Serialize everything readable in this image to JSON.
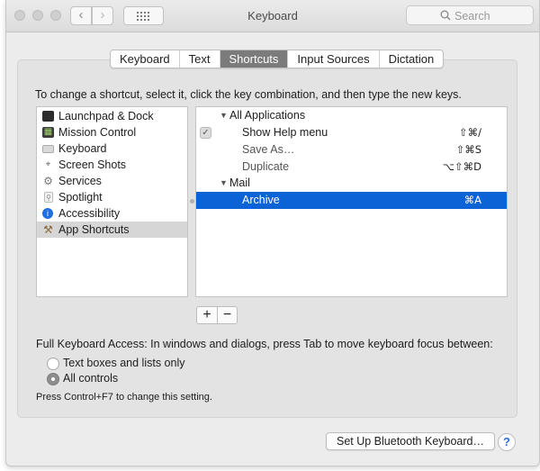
{
  "window": {
    "title": "Keyboard",
    "search_placeholder": "Search",
    "nav_back": "‹",
    "nav_forward": "›"
  },
  "tabs": [
    {
      "label": "Keyboard",
      "active": false
    },
    {
      "label": "Text",
      "active": false
    },
    {
      "label": "Shortcuts",
      "active": true
    },
    {
      "label": "Input Sources",
      "active": false
    },
    {
      "label": "Dictation",
      "active": false
    }
  ],
  "instructions": "To change a shortcut, select it, click the key combination, and then type the new keys.",
  "categories": [
    {
      "label": "Launchpad & Dock",
      "icon": "launchpad-dock-icon",
      "selected": false
    },
    {
      "label": "Mission Control",
      "icon": "mission-control-icon",
      "selected": false
    },
    {
      "label": "Keyboard",
      "icon": "keyboard-icon",
      "selected": false
    },
    {
      "label": "Screen Shots",
      "icon": "camera-icon",
      "selected": false
    },
    {
      "label": "Services",
      "icon": "gear-icon",
      "selected": false
    },
    {
      "label": "Spotlight",
      "icon": "spotlight-icon",
      "selected": false
    },
    {
      "label": "Accessibility",
      "icon": "accessibility-icon",
      "selected": false
    },
    {
      "label": "App Shortcuts",
      "icon": "app-shortcuts-icon",
      "selected": true
    }
  ],
  "shortcuts": {
    "group_all": "All Applications",
    "show_help": {
      "label": "Show Help menu",
      "keys": "⇧⌘/",
      "checked": true
    },
    "save_as": {
      "label": "Save As…",
      "keys": "⇧⌘S"
    },
    "duplicate": {
      "label": "Duplicate",
      "keys": "⌥⇧⌘D"
    },
    "group_mail": "Mail",
    "archive": {
      "label": "Archive",
      "keys": "⌘A",
      "selected": true
    }
  },
  "buttons": {
    "add": "+",
    "remove": "−",
    "bluetooth": "Set Up Bluetooth Keyboard…",
    "help": "?"
  },
  "full_keyboard_access": {
    "label": "Full Keyboard Access: In windows and dialogs, press Tab to move keyboard focus between:",
    "option_text_boxes": "Text boxes and lists only",
    "option_all_controls": "All controls",
    "selected": "All controls",
    "note": "Press Control+F7 to change this setting."
  },
  "colors": {
    "selection": "#0c63d6",
    "tab_active": "#7b7b7b"
  }
}
